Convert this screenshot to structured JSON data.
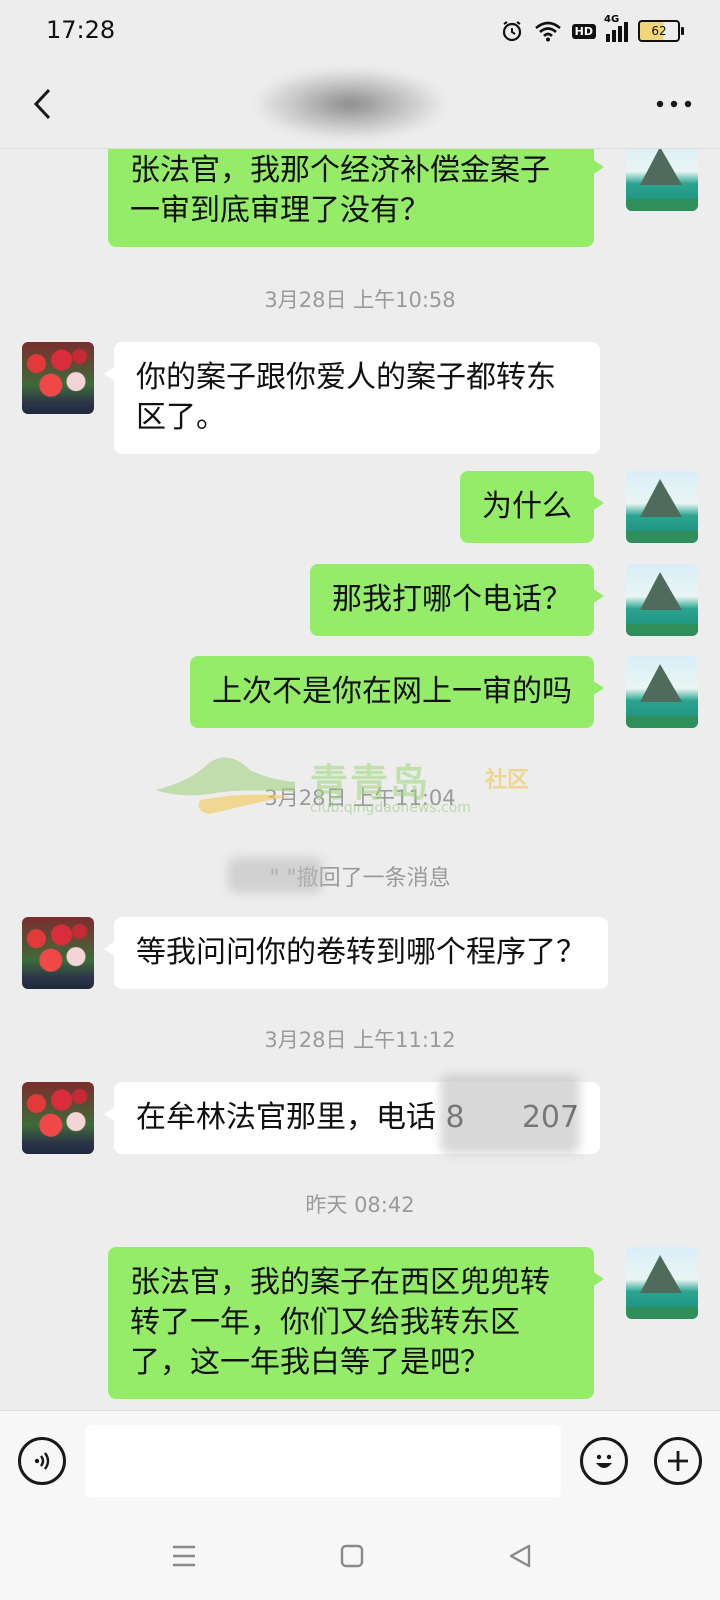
{
  "status_bar": {
    "time": "17:28",
    "network": "4G",
    "hd_label": "HD",
    "battery": "62"
  },
  "header": {
    "back_icon": "chevron-left-icon",
    "more_icon": "more-dots-icon"
  },
  "messages": [
    {
      "type": "msg",
      "side": "self",
      "text": "张法官，我那个经济补偿金案子一审到底审理了没有？"
    },
    {
      "type": "time",
      "text": "3月28日 上午10:58"
    },
    {
      "type": "msg",
      "side": "other",
      "text": "你的案子跟你爱人的案子都转东区了。"
    },
    {
      "type": "msg",
      "side": "self",
      "text": "为什么"
    },
    {
      "type": "msg",
      "side": "self",
      "text": "那我打哪个电话？"
    },
    {
      "type": "msg",
      "side": "self",
      "text": "上次不是你在网上一审的吗"
    },
    {
      "type": "time",
      "text": "3月28日 上午11:04"
    },
    {
      "type": "recall",
      "text": "\"           \"撤回了一条消息"
    },
    {
      "type": "msg",
      "side": "other",
      "text": "等我问问你的卷转到哪个程序了？"
    },
    {
      "type": "time",
      "text": "3月28日 上午11:12"
    },
    {
      "type": "msg",
      "side": "other",
      "text": "在牟林法官那里，电话 8      207"
    },
    {
      "type": "time",
      "text": "昨天 08:42"
    },
    {
      "type": "msg",
      "side": "self",
      "text": "张法官，我的案子在西区兜兜转转了一年，你们又给我转东区了，这一年我白等了是吧？"
    }
  ],
  "watermark": {
    "name": "青青岛",
    "tag": "社区",
    "url": "club.qingdaonews.com"
  },
  "input_bar": {
    "voice_icon": "voice-icon",
    "emoji_icon": "emoji-icon",
    "plus_icon": "plus-icon",
    "input_value": ""
  },
  "system_nav": {
    "menu_icon": "menu-icon",
    "home_icon": "home-icon",
    "back_icon": "triangle-back-icon"
  },
  "colors": {
    "self_bubble": "#95ec69",
    "other_bubble": "#ffffff",
    "background": "#ededed"
  }
}
